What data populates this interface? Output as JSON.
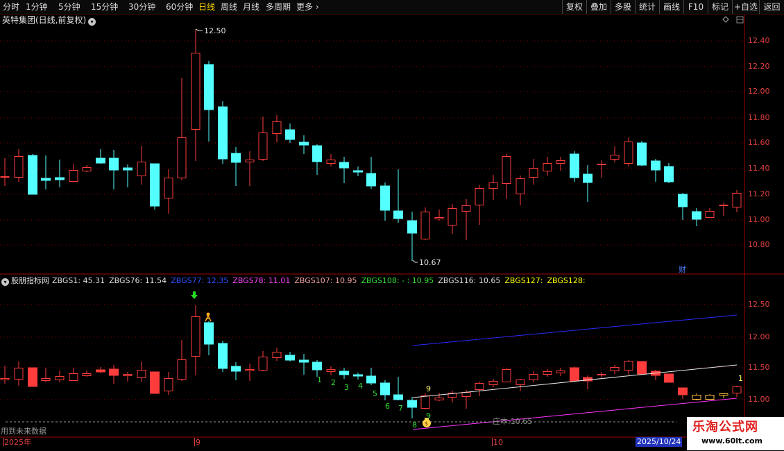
{
  "toolbar": {
    "periods": [
      "分时",
      "1分钟",
      "5分钟",
      "15分钟",
      "30分钟",
      "60分钟",
      "日线",
      "周线",
      "月线",
      "多周期",
      "更多 ›"
    ],
    "active_period": "日线",
    "right_buttons": [
      "复权",
      "叠加",
      "多股",
      "统计",
      "画线",
      "F10",
      "标记",
      "+自选",
      "返回"
    ]
  },
  "main_chart": {
    "title": "英特集团(日线,前复权)",
    "high_label": "12.50",
    "low_label": "10.67",
    "y_ticks": [
      "12.40",
      "12.20",
      "12.00",
      "11.80",
      "11.60",
      "11.40",
      "11.20",
      "11.00",
      "10.80"
    ],
    "finance_marker": "财"
  },
  "indicator": {
    "name": "股朋指标网",
    "fields": [
      {
        "text": "ZBGS1: 45.31",
        "color": "#dddddd"
      },
      {
        "text": "ZBGS76: 11.54",
        "color": "#dddddd"
      },
      {
        "text": "ZBGS77: 12.35",
        "color": "#3050ff"
      },
      {
        "text": "ZBGS78: 11.01",
        "color": "#ff44ff"
      },
      {
        "text": "ZBGS107: 10.95",
        "color": "#f0a0a0"
      },
      {
        "text": "ZBGS108: - : 10.95",
        "color": "#33dd33"
      },
      {
        "text": "ZBGS116: 10.65",
        "color": "#dddddd"
      },
      {
        "text": "ZBGS127:",
        "color": "#ffff00"
      },
      {
        "text": "ZBGS128:",
        "color": "#ffff00"
      }
    ],
    "y_ticks": [
      "12.50",
      "12.00",
      "11.50",
      "11.00"
    ],
    "counts_down": [
      "1",
      "2",
      "3",
      "4",
      "5",
      "6",
      "7",
      "8"
    ],
    "count_nine_top": "9",
    "count_nine_bottom": "9",
    "count_one_right": "1",
    "zhuangben_label": "庄本:10.65",
    "future_warning": "用到未来数据"
  },
  "date_axis": {
    "labels": [
      "2025年",
      "9",
      "10",
      "2025/10/24"
    ]
  },
  "watermark": {
    "title": "乐淘公式网",
    "url": "www.60lt.com"
  },
  "colors": {
    "up": "#ff3c3c",
    "down": "#54ffff",
    "axis": "#a00000"
  }
}
